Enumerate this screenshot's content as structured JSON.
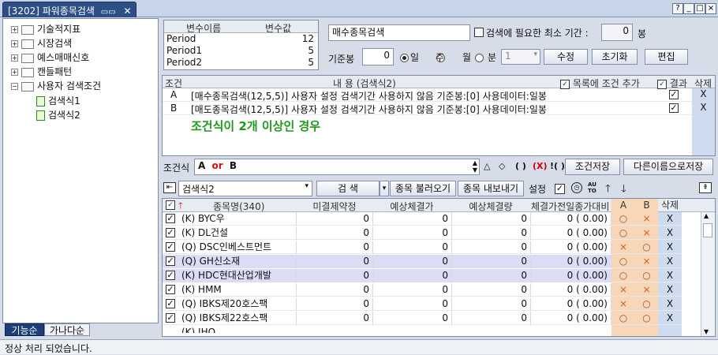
{
  "window": {
    "title": "[3202] 파워종목검색",
    "tab_icon": "dual-monitor-icon",
    "close_glyph": "✕"
  },
  "window_buttons": [
    "?",
    "_",
    "□",
    "×"
  ],
  "tree": {
    "items": [
      {
        "label": "기술적지표",
        "expand": "+"
      },
      {
        "label": "시장검색",
        "expand": "+"
      },
      {
        "label": "예스매매신호",
        "expand": "+"
      },
      {
        "label": "캔들패턴",
        "expand": "+"
      },
      {
        "label": "사용자 검색조건",
        "expand": "−"
      },
      {
        "label": "검색식1"
      },
      {
        "label": "검색식2"
      }
    ],
    "tabs": [
      "기능순",
      "가나다순"
    ]
  },
  "vars": {
    "headers": [
      "변수이름",
      "변수값"
    ],
    "rows": [
      [
        "Period",
        "12"
      ],
      [
        "Period1",
        "5"
      ],
      [
        "Period2",
        "5"
      ]
    ]
  },
  "search": {
    "name": "매수종목검색",
    "min_period_label": "검색에 필요한 최소 기간 :",
    "min_period_value": "0",
    "bong": "봉",
    "base_label": "기준봉",
    "base_value": "0",
    "periods": [
      "일",
      "주",
      "월",
      "분"
    ],
    "selected_period": "일",
    "minute_value": "1",
    "buttons": [
      "수정",
      "초기화",
      "편집"
    ]
  },
  "cond": {
    "headers": {
      "col": "조건",
      "content": "내    용 (검색식2)",
      "add": "목록에 조건 추가",
      "result": "결과",
      "del": "삭제"
    },
    "rows": [
      {
        "id": "A",
        "text": "[매수종목검색(12,5,5)] 사용자 설정 검색기간 사용하지 않음 기준봉:[0] 사용데이터:일봉",
        "del": "X"
      },
      {
        "id": "B",
        "text": "[매도종목검색(12,5,5)] 사용자 설정 검색기간 사용하지 않음 기준봉:[0] 사용데이터:일봉",
        "del": "X"
      }
    ],
    "annotation": "조건식이 2개 이상인 경우"
  },
  "formula": {
    "label": "조건식",
    "tokens": [
      "A",
      "or",
      "B"
    ],
    "ops": [
      "△",
      "◇",
      "( )",
      "(X)",
      "!( )"
    ],
    "save": "조건저장",
    "save_as": "다른이름으로저장"
  },
  "toolbar": {
    "selected": "검색식2",
    "search": "검    색",
    "load": "종목 불러오기",
    "export": "종목 내보내기",
    "settings": "설정",
    "auto": "AUTO"
  },
  "results": {
    "headers": [
      "종목명(340)",
      "미결제약정",
      "예상체결가",
      "예상체결량",
      "체결가전일종가대비(",
      "A",
      "B",
      "삭제"
    ],
    "rows": [
      {
        "name": "(K) BYC우",
        "v1": "0",
        "v2": "0",
        "v3": "0",
        "v4": "0 ( 0.00)",
        "a": "○",
        "b": "×",
        "hl": false
      },
      {
        "name": "(K) DL건설",
        "v1": "0",
        "v2": "0",
        "v3": "0",
        "v4": "0 ( 0.00)",
        "a": "○",
        "b": "×",
        "hl": false
      },
      {
        "name": "(Q) DSC인베스트먼트",
        "v1": "0",
        "v2": "0",
        "v3": "0",
        "v4": "0 ( 0.00)",
        "a": "×",
        "b": "○",
        "hl": false
      },
      {
        "name": "(Q) GH신소재",
        "v1": "0",
        "v2": "0",
        "v3": "0",
        "v4": "0 ( 0.00)",
        "a": "○",
        "b": "×",
        "hl": true
      },
      {
        "name": "(K) HDC현대산업개발",
        "v1": "0",
        "v2": "0",
        "v3": "0",
        "v4": "0 ( 0.00)",
        "a": "○",
        "b": "○",
        "hl": true
      },
      {
        "name": "(K) HMM",
        "v1": "0",
        "v2": "0",
        "v3": "0",
        "v4": "0 ( 0.00)",
        "a": "×",
        "b": "×",
        "hl": false
      },
      {
        "name": "(Q) IBKS제20호스팩",
        "v1": "0",
        "v2": "0",
        "v3": "0",
        "v4": "0 ( 0.00)",
        "a": "×",
        "b": "○",
        "hl": false
      },
      {
        "name": "(Q) IBKS제22호스팩",
        "v1": "0",
        "v2": "0",
        "v3": "0",
        "v4": "0 ( 0.00)",
        "a": "○",
        "b": "○",
        "hl": false
      }
    ],
    "del": "X",
    "partial_row": "(K) IHQ"
  },
  "status": "정상 처리 되었습니다.",
  "colors": {
    "title_bg": "#2d4f86",
    "annotation": "#1f9a1f",
    "formula_or": "#d01010",
    "ab_col": "#f7d7b8",
    "del_col": "#cfdcf0",
    "highlight": "#dcdcf5"
  }
}
